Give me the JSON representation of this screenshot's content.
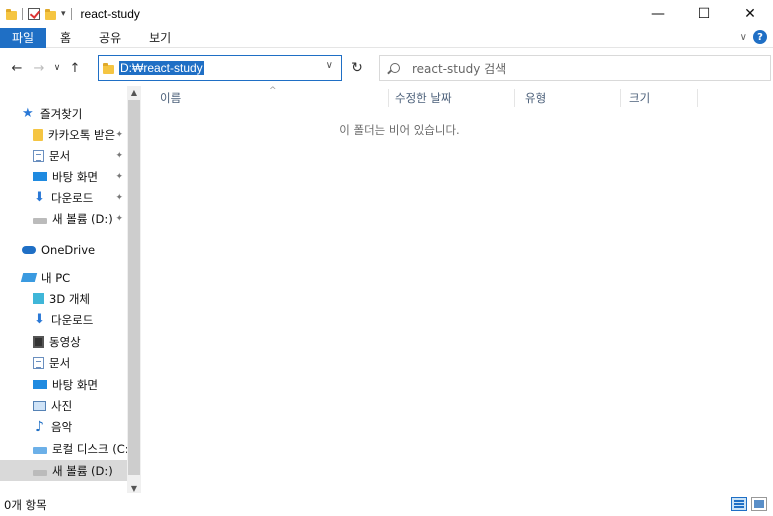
{
  "window": {
    "title": "react-study",
    "minimize_glyph": "—",
    "maximize_glyph": "☐",
    "close_glyph": "✕"
  },
  "ribbon": {
    "tabs": [
      "파일",
      "홈",
      "공유",
      "보기"
    ],
    "help_glyph": "?"
  },
  "address": {
    "path": "D:₩react-study",
    "search_placeholder": "react-study 검색"
  },
  "nav": {
    "items": [
      {
        "label": "즐겨찾기",
        "icon": "star-icon"
      },
      {
        "label": "카카오톡 받은",
        "icon": "folder-icon",
        "pinned": true
      },
      {
        "label": "문서",
        "icon": "document-icon",
        "pinned": true
      },
      {
        "label": "바탕 화면",
        "icon": "desktop-icon",
        "pinned": true
      },
      {
        "label": "다운로드",
        "icon": "download-icon",
        "pinned": true
      },
      {
        "label": "새 볼륨 (D:)",
        "icon": "drive-icon",
        "pinned": true
      },
      {
        "label": "OneDrive",
        "icon": "cloud-icon"
      },
      {
        "label": "내 PC",
        "icon": "pc-icon"
      },
      {
        "label": "3D 개체",
        "icon": "cube-icon"
      },
      {
        "label": "다운로드",
        "icon": "download-icon"
      },
      {
        "label": "동영상",
        "icon": "video-icon"
      },
      {
        "label": "문서",
        "icon": "document-icon"
      },
      {
        "label": "바탕 화면",
        "icon": "desktop-icon"
      },
      {
        "label": "사진",
        "icon": "picture-icon"
      },
      {
        "label": "음악",
        "icon": "music-icon"
      },
      {
        "label": "로컬 디스크 (C:)",
        "icon": "c-drive-icon"
      },
      {
        "label": "새 볼륨 (D:)",
        "icon": "drive-icon",
        "selected": true
      }
    ]
  },
  "columns": {
    "name": "이름",
    "modified": "수정한 날짜",
    "type": "유형",
    "size": "크기"
  },
  "content": {
    "empty_message": "이 폴더는 비어 있습니다."
  },
  "status": {
    "item_count": "0개 항목"
  },
  "colors": {
    "accent": "#1f6fc5",
    "selection": "#d9d9d9"
  }
}
